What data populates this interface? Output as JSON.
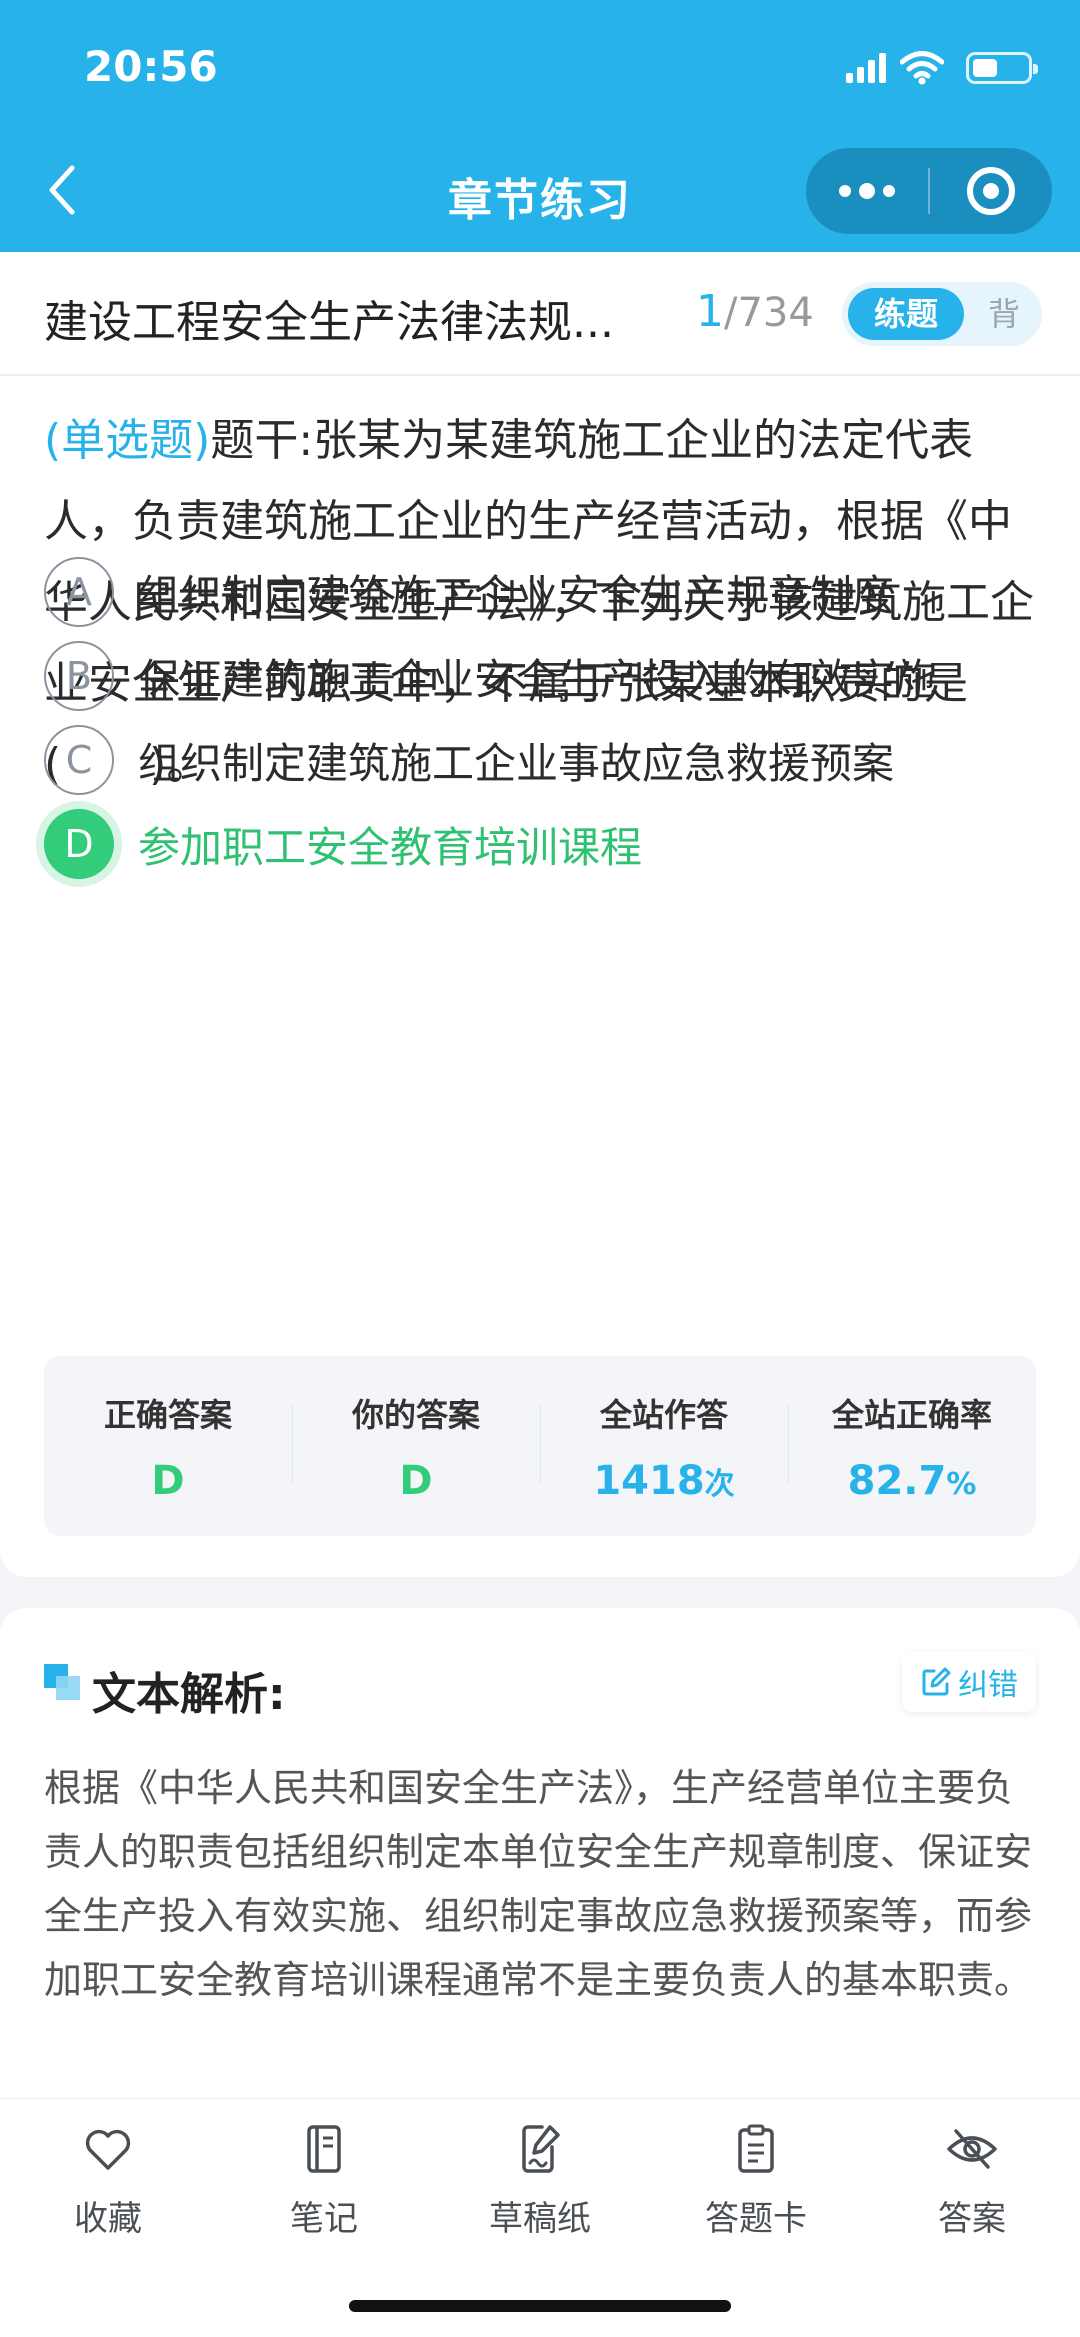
{
  "status": {
    "time": "20:56"
  },
  "nav": {
    "title": "章节练习"
  },
  "chapter": {
    "title": "建设工程安全生产法律法规...",
    "current": "1",
    "total": "/734",
    "mode_practice": "练题",
    "mode_recite": "背"
  },
  "question": {
    "type": "(单选题)",
    "stem": "题干:张某为某建筑施工企业的法定代表人，负责建筑施工企业的生产经营活动，根据《中华人民共和国安全生产法》，下列关于该建筑施工企业安全生产的职责中，不属于张某基本职责的是(　　)。",
    "options": [
      {
        "letter": "A",
        "text": "组织制定建筑施工企业安全生产规章制度"
      },
      {
        "letter": "B",
        "text": "保证建筑施工企业安全生产投入的有效实施"
      },
      {
        "letter": "C",
        "text": "组织制定建筑施工企业事故应急救援预案"
      },
      {
        "letter": "D",
        "text": "参加职工安全教育培训课程"
      }
    ],
    "selected": "D"
  },
  "stats": {
    "correct_label": "正确答案",
    "correct_value": "D",
    "yours_label": "你的答案",
    "yours_value": "D",
    "attempts_label": "全站作答",
    "attempts_value": "1418",
    "attempts_unit": "次",
    "rate_label": "全站正确率",
    "rate_value": "82.7",
    "rate_unit": "%"
  },
  "analysis": {
    "title": "文本解析:",
    "report_label": "纠错",
    "text": "根据《中华人民共和国安全生产法》，生产经营单位主要负责人的职责包括组织制定本单位安全生产规章制度、保证安全生产投入有效实施、组织制定事故应急救援预案等，而参加职工安全教育培训课程通常不是主要负责人的基本职责。"
  },
  "bottom_tabs": [
    {
      "label": "收藏",
      "icon": "heart-icon"
    },
    {
      "label": "笔记",
      "icon": "notebook-icon"
    },
    {
      "label": "草稿纸",
      "icon": "draft-paper-icon"
    },
    {
      "label": "答题卡",
      "icon": "answer-sheet-icon"
    },
    {
      "label": "答案",
      "icon": "eye-off-icon"
    }
  ],
  "colors": {
    "brand": "#27b2ea",
    "correct": "#33cc7a",
    "background": "#f2f4f7"
  }
}
